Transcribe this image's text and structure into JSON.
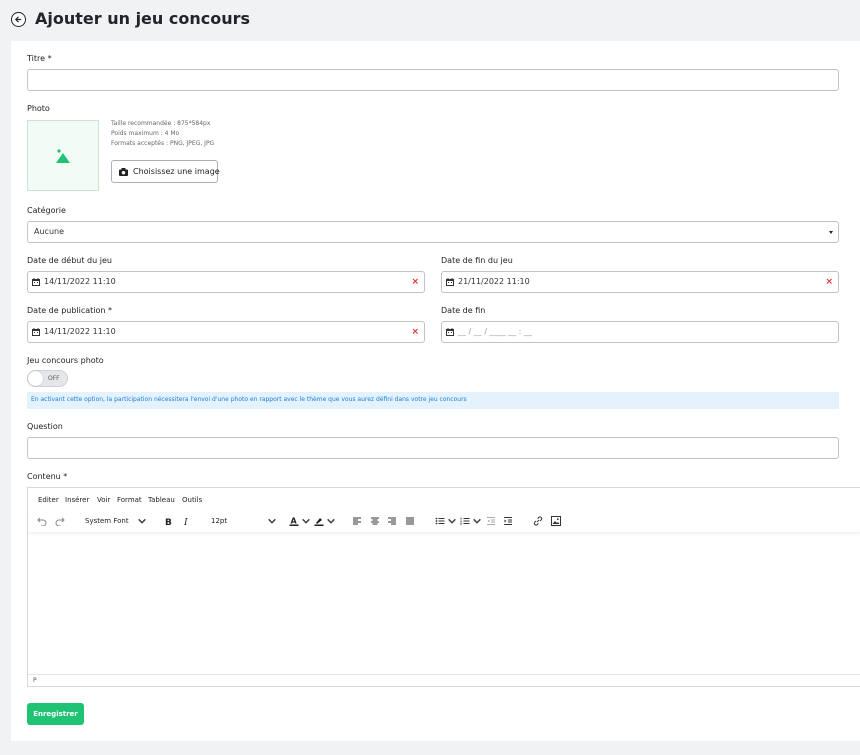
{
  "header": {
    "title": "Ajouter un jeu concours"
  },
  "form": {
    "titre_label": "Titre *",
    "titre_value": "",
    "photo_label": "Photo",
    "photo_hints": [
      "Taille recommandée : 875*584px",
      "Poids maximum : 4 Mo",
      "Formats acceptés : PNG, JPEG, JPG"
    ],
    "choose_image_label": "Choisissez une image",
    "categorie_label": "Catégorie",
    "categorie_value": "Aucune",
    "date_debut_label": "Date de début du jeu",
    "date_debut_value": "14/11/2022 11:10",
    "date_fin_jeu_label": "Date de fin du jeu",
    "date_fin_jeu_value": "21/11/2022 11:10",
    "date_publication_label": "Date de publication *",
    "date_publication_value": "14/11/2022 11:10",
    "date_fin_label": "Date de fin",
    "date_fin_placeholder": "__ / __ / ____ __ : __",
    "jeu_photo_label": "Jeu concours photo",
    "toggle_label": "OFF",
    "toggle_state": "off",
    "info_text": "En activant cette option, la participation nécessitera l'envoi d'une photo en rapport avec le thème que vous aurez défini dans votre jeu concours",
    "question_label": "Question",
    "question_value": "",
    "contenu_label": "Contenu *"
  },
  "editor": {
    "menu": [
      "Editer",
      "Insérer",
      "Voir",
      "Format",
      "Tableau",
      "Outils"
    ],
    "font_family": "System Font",
    "font_size": "12pt",
    "status_path": "P"
  },
  "actions": {
    "save_label": "Enregistrer"
  },
  "colors": {
    "accent": "#20c373",
    "info_bg": "#e3f2fd",
    "info_text": "#1c7ed6",
    "danger": "#e03131"
  }
}
